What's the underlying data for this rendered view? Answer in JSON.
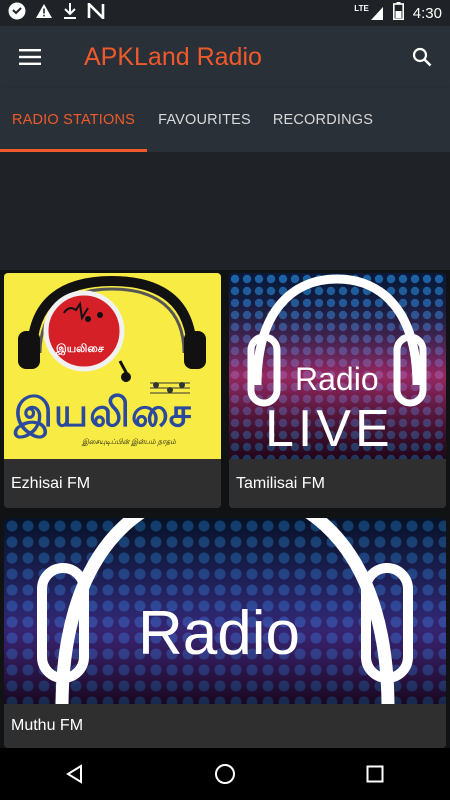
{
  "status_bar": {
    "icons": [
      "vpn-heart-icon",
      "warning-icon",
      "download-icon",
      "n-app-icon"
    ],
    "network_label": "LTE",
    "time": "4:30"
  },
  "app_bar": {
    "title": "APKLand Radio",
    "title_color": "#f05a2a",
    "menu_icon": "hamburger-menu-icon",
    "search_icon": "search-icon"
  },
  "tabs": [
    {
      "label": "RADIO STATIONS",
      "active": true
    },
    {
      "label": "FAVOURITES",
      "active": false
    },
    {
      "label": "RECORDINGS",
      "active": false
    }
  ],
  "stations": [
    {
      "name": "Ezhisai FM",
      "logo_text": "இயலிசை",
      "logo_badge": "இயலிசை",
      "logo_caption": "இசையுடிப்பின் இன்பம் நாதம்"
    },
    {
      "name": "Tamilisai FM",
      "logo_line1": "Radio",
      "logo_line2": "LIVE"
    },
    {
      "name": "Muthu FM",
      "logo_line1": "Radio"
    }
  ],
  "nav_bar": {
    "icons": [
      "back-icon",
      "home-icon",
      "recents-icon"
    ]
  }
}
